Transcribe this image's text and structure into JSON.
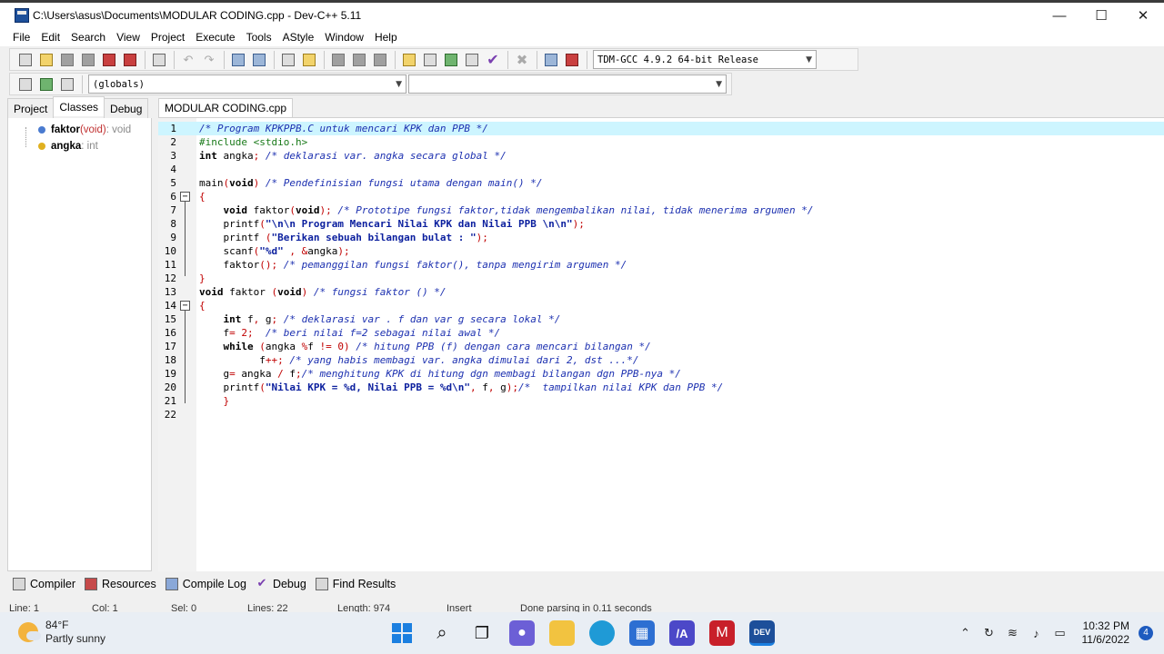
{
  "window": {
    "title": "C:\\Users\\asus\\Documents\\MODULAR CODING.cpp - Dev-C++ 5.11",
    "minimize": "—",
    "maximize": "☐",
    "close": "✕"
  },
  "menu": [
    "File",
    "Edit",
    "Search",
    "View",
    "Project",
    "Execute",
    "Tools",
    "AStyle",
    "Window",
    "Help"
  ],
  "toolbar": {
    "compiler_select": "TDM-GCC 4.9.2 64-bit Release",
    "scope_select": "(globals)",
    "member_select": ""
  },
  "left_panel": {
    "tabs": [
      "Project",
      "Classes",
      "Debug"
    ],
    "active_tab": "Classes",
    "items": [
      {
        "name": "faktor",
        "type_open": "(void)",
        "type_rest": " : void"
      },
      {
        "name": "angka",
        "type_open": "",
        "type_rest": " : int"
      }
    ]
  },
  "editor": {
    "tab_label": "MODULAR CODING.cpp",
    "lines": [
      "/* Program KPKPPB.C untuk mencari KPK dan PPB */",
      "#include <stdio.h>",
      "int angka; /* deklarasi var. angka secara global */",
      "",
      "main(void) /* Pendefinisian fungsi utama dengan main() */",
      "{",
      "    void faktor(void); /* Prototipe fungsi faktor,tidak mengembalikan nilai, tidak menerima argumen */",
      "    printf(\"\\n\\n Program Mencari Nilai KPK dan Nilai PPB \\n\\n\");",
      "    printf (\"Berikan sebuah bilangan bulat : \");",
      "    scanf(\"%d\" , &angka);",
      "    faktor(); /* pemanggilan fungsi faktor(), tanpa mengirim argumen */",
      "}",
      "void faktor (void) /* fungsi faktor () */",
      "{",
      "    int f, g; /* deklarasi var . f dan var g secara lokal */",
      "    f= 2;  /* beri nilai f=2 sebagai nilai awal */",
      "    while (angka %f != 0) /* hitung PPB (f) dengan cara mencari bilangan */",
      "          f++; /* yang habis membagi var. angka dimulai dari 2, dst ...*/",
      "    g= angka / f;/* menghitung KPK di hitung dgn membagi bilangan dgn PPB-nya */",
      "    printf(\"Nilai KPK = %d, Nilai PPB = %d\\n\", f, g);/*  tampilkan nilai KPK dan PPB */",
      "    }",
      ""
    ]
  },
  "bottom_tabs": [
    "Compiler",
    "Resources",
    "Compile Log",
    "Debug",
    "Find Results"
  ],
  "status": {
    "line": "Line:   1",
    "col": "Col:   1",
    "sel": "Sel:   0",
    "lines": "Lines:   22",
    "length": "Length:   974",
    "mode": "Insert",
    "message": "Done parsing in 0.11 seconds"
  },
  "taskbar": {
    "temperature": "84°F",
    "weather": "Partly sunny",
    "time": "10:32 PM",
    "date": "11/6/2022",
    "notifications": "4"
  }
}
